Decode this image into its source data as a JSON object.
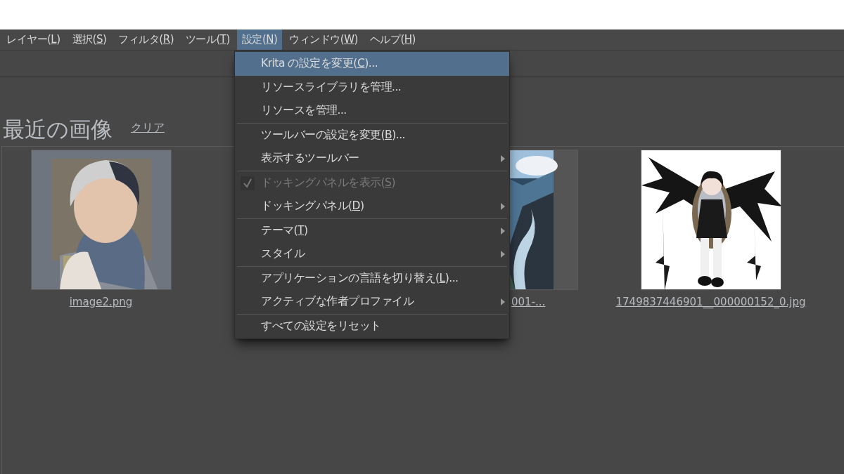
{
  "menubar": [
    {
      "text": "レイヤー(",
      "accel": "L",
      "suffix": ")",
      "selected": false
    },
    {
      "text": "選択(",
      "accel": "S",
      "suffix": ")",
      "selected": false
    },
    {
      "text": "フィルタ(",
      "accel": "R",
      "suffix": ")",
      "selected": false
    },
    {
      "text": "ツール(",
      "accel": "T",
      "suffix": ")",
      "selected": false
    },
    {
      "text": "設定(",
      "accel": "N",
      "suffix": ")",
      "selected": true
    },
    {
      "text": "ウィンドウ(",
      "accel": "W",
      "suffix": ")",
      "selected": false
    },
    {
      "text": "ヘルプ(",
      "accel": "H",
      "suffix": ")",
      "selected": false
    }
  ],
  "recent": {
    "title": "最近の画像",
    "clear": "クリア",
    "items": [
      {
        "label": "image2.png",
        "kind": "portrait",
        "covered": false
      },
      {
        "label": "001-...",
        "kind": "mountains",
        "covered": true
      },
      {
        "label": "1749837446901__000000152_0.jpg",
        "kind": "winged",
        "covered": false
      }
    ]
  },
  "menu": {
    "groups": [
      [
        {
          "text": "Krita の設定を変更(",
          "accel": "C",
          "suffix": ")...",
          "selected": true,
          "submenu": false,
          "checked": false,
          "disabled": false
        },
        {
          "text": "リソースライブラリを管理...",
          "selected": false,
          "submenu": false,
          "checked": false,
          "disabled": false
        },
        {
          "text": "リソースを管理...",
          "selected": false,
          "submenu": false,
          "checked": false,
          "disabled": false
        }
      ],
      [
        {
          "text": "ツールバーの設定を変更(",
          "accel": "B",
          "suffix": ")...",
          "selected": false,
          "submenu": false,
          "checked": false,
          "disabled": false
        },
        {
          "text": "表示するツールバー",
          "selected": false,
          "submenu": true,
          "checked": false,
          "disabled": false
        }
      ],
      [
        {
          "text": "ドッキングパネルを表示(",
          "accel": "S",
          "suffix": ")",
          "selected": false,
          "submenu": false,
          "checked": true,
          "disabled": true
        },
        {
          "text": "ドッキングパネル(",
          "accel": "D",
          "suffix": ")",
          "selected": false,
          "submenu": true,
          "checked": false,
          "disabled": false
        }
      ],
      [
        {
          "text": "テーマ(",
          "accel": "T",
          "suffix": ")",
          "selected": false,
          "submenu": true,
          "checked": false,
          "disabled": false
        },
        {
          "text": "スタイル",
          "selected": false,
          "submenu": true,
          "checked": false,
          "disabled": false
        }
      ],
      [
        {
          "text": "アプリケーションの言語を切り替え(",
          "accel": "L",
          "suffix": ")...",
          "selected": false,
          "submenu": false,
          "checked": false,
          "disabled": false
        },
        {
          "text": "アクティブな作者プロファイル",
          "selected": false,
          "submenu": true,
          "checked": false,
          "disabled": false
        }
      ],
      [
        {
          "text": "すべての設定をリセット",
          "selected": false,
          "submenu": false,
          "checked": false,
          "disabled": false
        }
      ]
    ]
  }
}
